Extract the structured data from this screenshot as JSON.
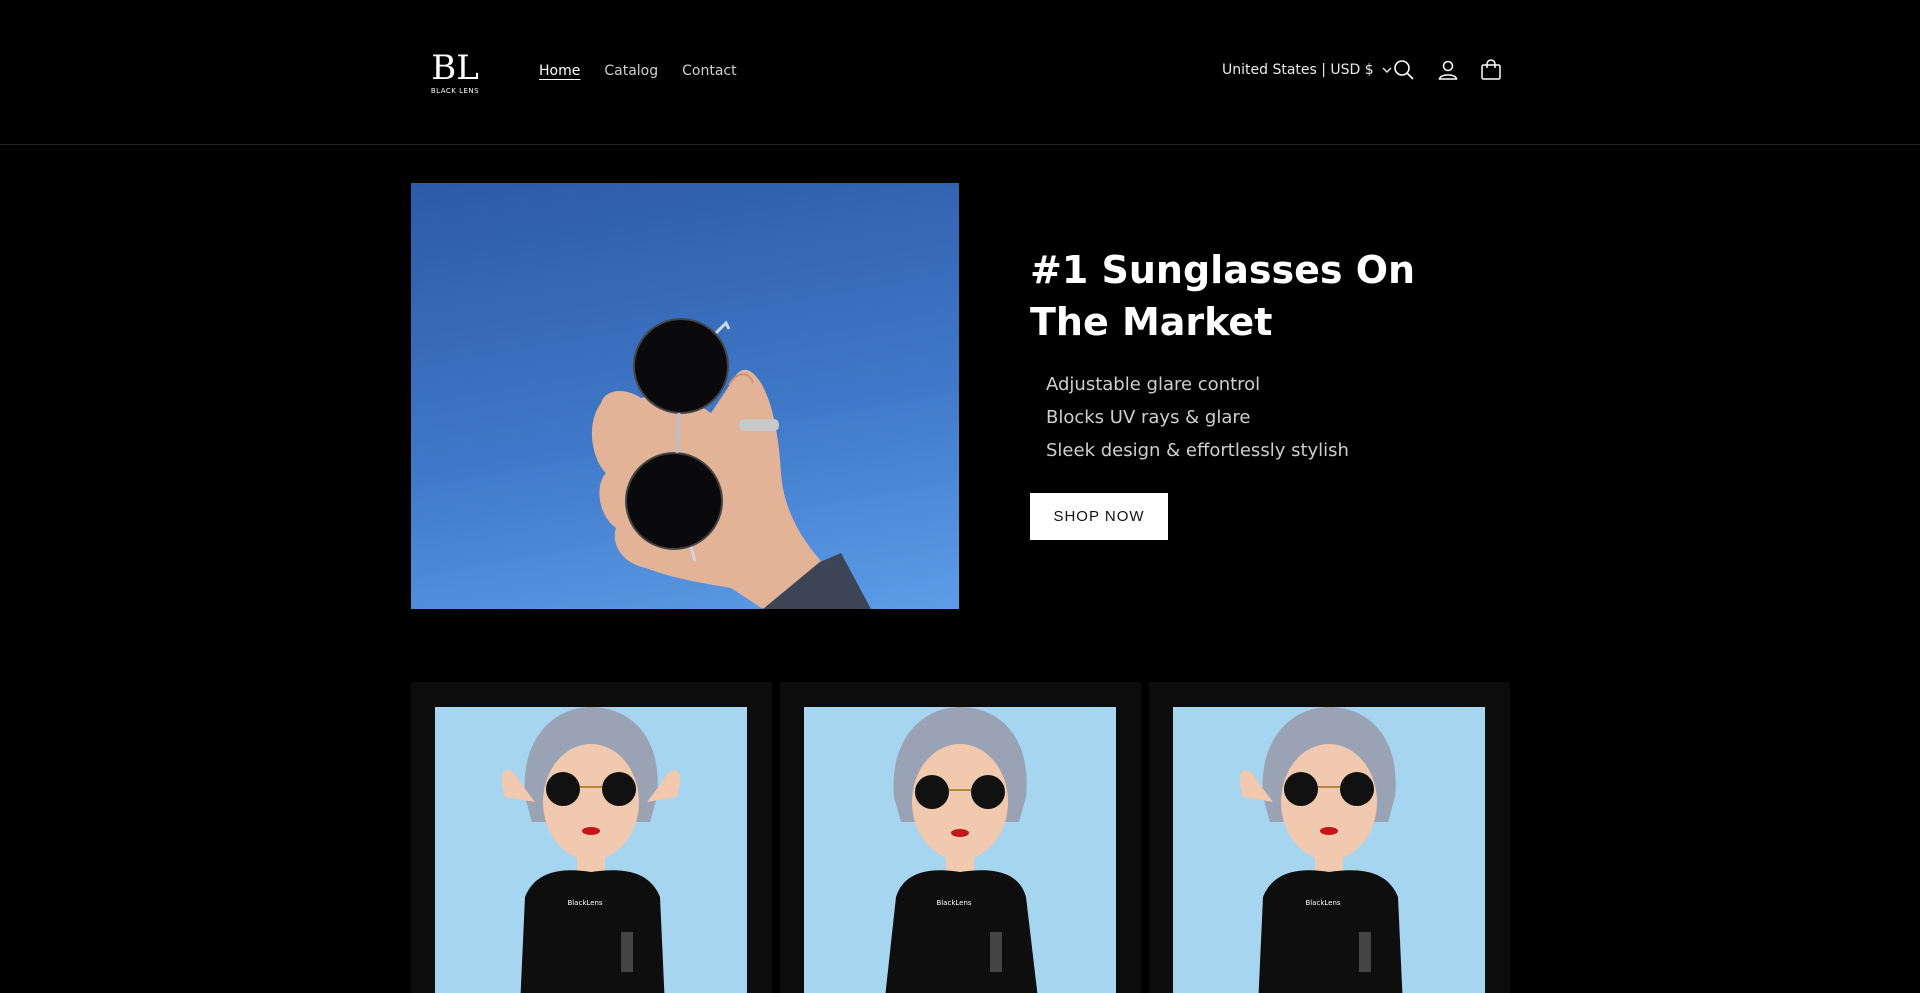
{
  "brand": {
    "logo_monogram": "BL",
    "logo_text": "BLACK LENS"
  },
  "nav": {
    "items": [
      "Home",
      "Catalog",
      "Contact"
    ],
    "active": "Home"
  },
  "header": {
    "country_selector": "United States | USD $",
    "icons": [
      "search-icon",
      "account-icon",
      "cart-icon",
      "chevron-down-icon"
    ]
  },
  "hero": {
    "title": "#1 Sunglasses On The Market",
    "features": [
      "Adjustable glare control",
      "Blocks UV rays & glare",
      "Sleek design & effortlessly stylish"
    ],
    "cta_label": "SHOP NOW"
  },
  "products": [
    {
      "shirt_print": "BlackLens"
    },
    {
      "shirt_print": "BlackLens"
    },
    {
      "shirt_print": "BlackLens"
    }
  ],
  "colors": {
    "background": "#000000",
    "sky_blue": "#3f78c8",
    "card_bg": "#0c0c0c",
    "product_bg": "#a5d5ef"
  }
}
